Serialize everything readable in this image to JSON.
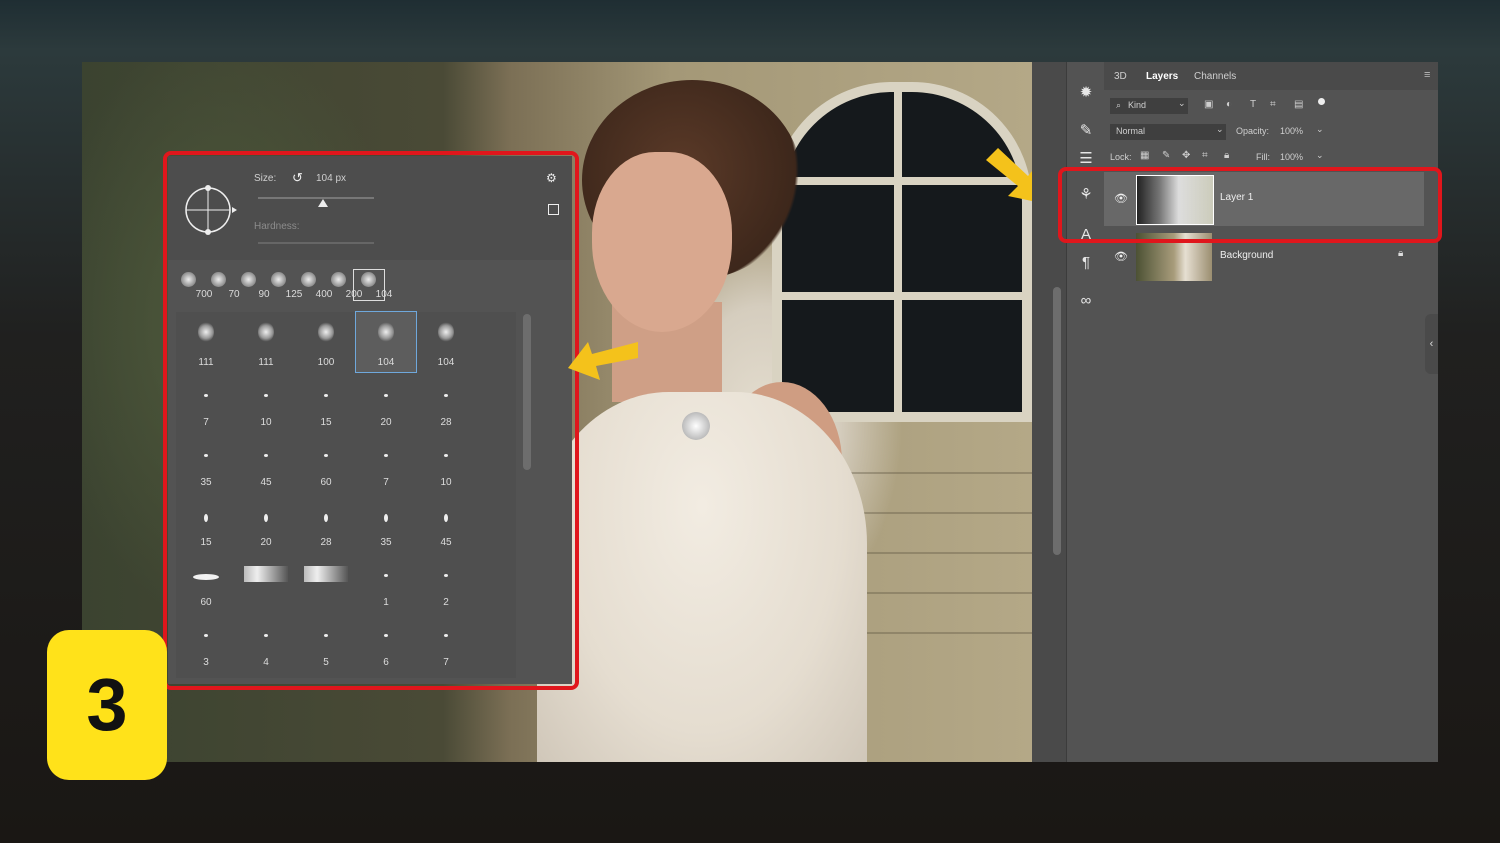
{
  "step_badge": "3",
  "brush_panel": {
    "size_label": "Size:",
    "size_value": "104 px",
    "hardness_label": "Hardness:",
    "size_fraction": 0.28,
    "recent_presets": [
      "700",
      "70",
      "90",
      "125",
      "400",
      "200",
      "104"
    ],
    "grid": [
      [
        "111",
        "111",
        "100",
        "104",
        "104"
      ],
      [
        "7",
        "10",
        "15",
        "20",
        "28"
      ],
      [
        "35",
        "45",
        "60",
        "7",
        "10"
      ],
      [
        "15",
        "20",
        "28",
        "35",
        "45"
      ],
      [
        "60",
        "",
        "",
        "1",
        "2"
      ],
      [
        "3",
        "4",
        "5",
        "6",
        "7"
      ]
    ],
    "selected_grid_item": "104"
  },
  "layers_panel": {
    "tabs": [
      "3D",
      "Layers",
      "Channels"
    ],
    "active_tab": "Layers",
    "filter_kind": "Kind",
    "blend_mode": "Normal",
    "opacity_label": "Opacity:",
    "opacity_value": "100%",
    "lock_label": "Lock:",
    "fill_label": "Fill:",
    "fill_value": "100%",
    "layers": [
      {
        "name": "Layer 1",
        "selected": true
      },
      {
        "name": "Background",
        "locked": true
      }
    ]
  },
  "colors": {
    "highlight_red": "#e0161c",
    "arrow_yellow": "#f4c21b",
    "badge_yellow": "#ffe21a",
    "panel_gray": "#535353"
  }
}
